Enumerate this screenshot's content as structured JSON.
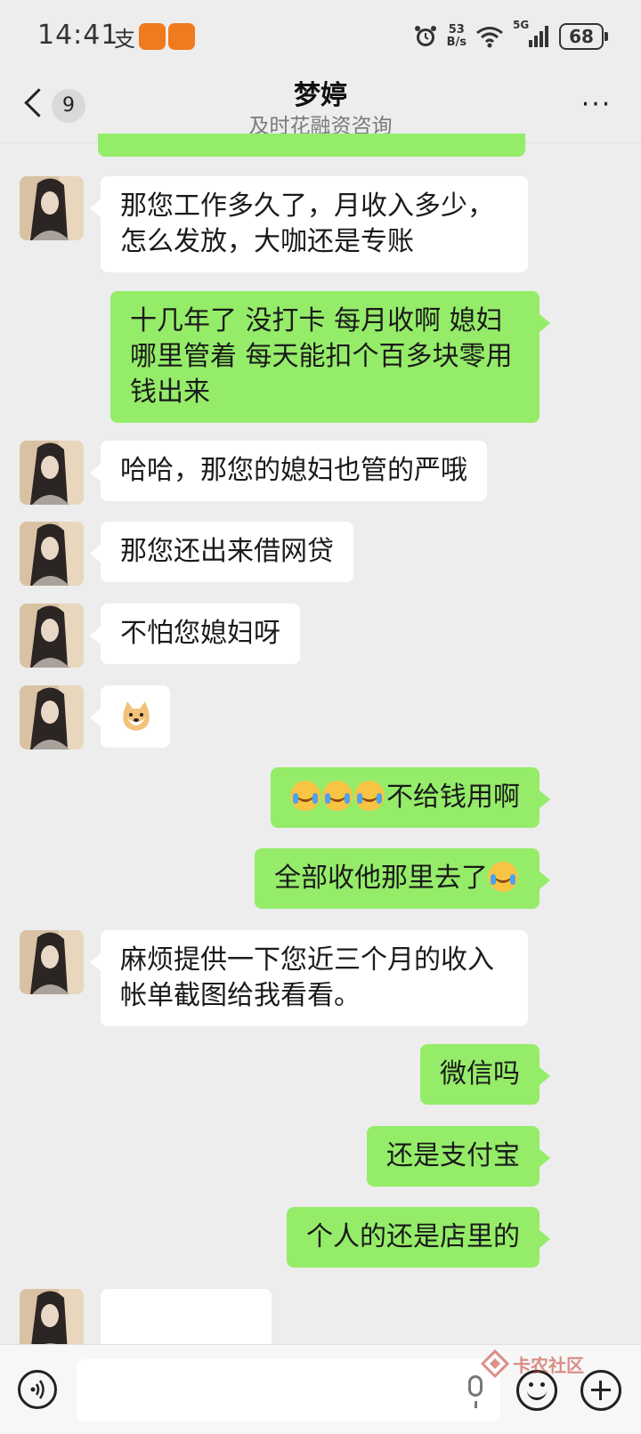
{
  "status_bar": {
    "time": "14:41",
    "alipay_glyph": "支",
    "app_icon_label": "",
    "net_speed_value": "53",
    "net_speed_unit": "B/s",
    "signal_label": "5G",
    "battery": "68"
  },
  "header": {
    "back_count": "9",
    "title": "梦婷",
    "subtitle": "及时花融资咨询",
    "more_label": "···"
  },
  "messages": [
    {
      "side": "in",
      "text": "那您工作多久了，月收入多少，怎么发放，大咖还是专账"
    },
    {
      "side": "out",
      "text": "十几年了  没打卡 每月收啊  媳妇哪里管着  每天能扣个百多块零用钱出来"
    },
    {
      "side": "in",
      "text": "哈哈，那您的媳妇也管的严哦"
    },
    {
      "side": "in",
      "text": "那您还出来借网贷"
    },
    {
      "side": "in",
      "text": "不怕您媳妇呀"
    },
    {
      "side": "in",
      "sticker": "doge-icon"
    },
    {
      "side": "out",
      "emoji_count": 3,
      "text": "不给钱用啊"
    },
    {
      "side": "out",
      "text": "全部收他那里去了",
      "emoji_after": 1
    },
    {
      "side": "in",
      "text": "麻烦提供一下您近三个月的收入帐单截图给我看看。"
    },
    {
      "side": "out",
      "text": "微信吗"
    },
    {
      "side": "out",
      "text": "还是支付宝"
    },
    {
      "side": "out",
      "text": "个人的还是店里的"
    }
  ],
  "watermark": {
    "text": "卡农社区"
  },
  "colors": {
    "incoming": "#ffffff",
    "outgoing": "#95ec69",
    "background": "#ededed"
  }
}
